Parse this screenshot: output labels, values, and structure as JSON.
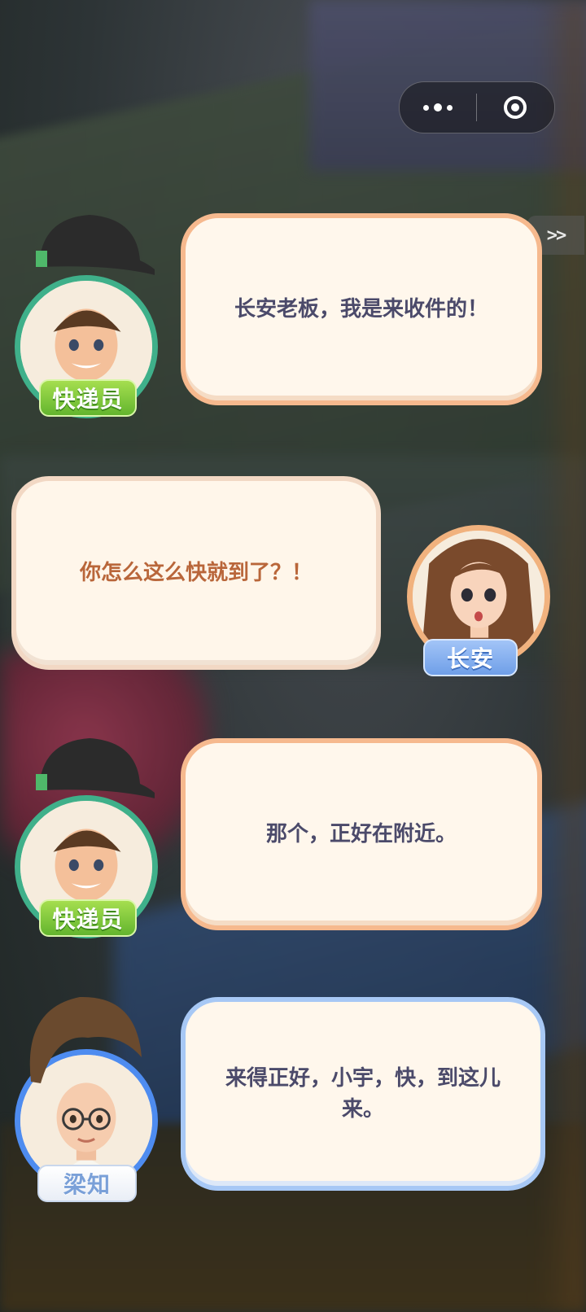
{
  "top_bar": {
    "more_icon": "three-dots-icon",
    "close_icon": "target-ring-icon"
  },
  "skip_button": {
    "label": ">>"
  },
  "dialogues": [
    {
      "speaker": "快递员",
      "text": "长安老板，我是来收件的！",
      "side": "left",
      "theme": "green"
    },
    {
      "speaker": "长安",
      "text": "你怎么这么快就到了？！",
      "side": "right",
      "theme": "orange"
    },
    {
      "speaker": "快递员",
      "text": "那个，正好在附近。",
      "side": "left",
      "theme": "green"
    },
    {
      "speaker": "梁知",
      "text": "来得正好，小宇，快，到这儿来。",
      "side": "left",
      "theme": "blue"
    }
  ],
  "colors": {
    "courier_border": "#3fb08a",
    "changan_border": "#f1b27e",
    "liangzhi_border": "#4e8cf0",
    "bubble_fill": "#fff7ec",
    "dialogue_text": "#4b4a6a",
    "player_text": "#b9663a"
  }
}
